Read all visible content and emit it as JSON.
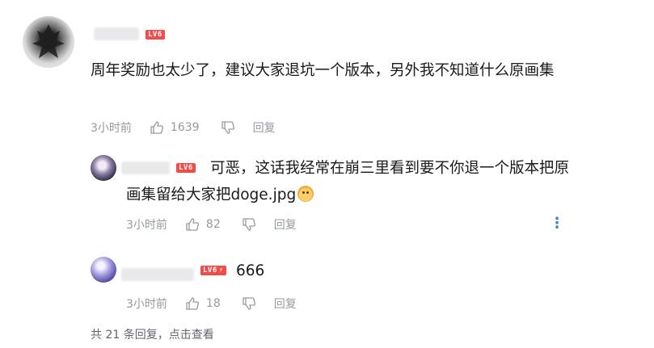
{
  "comments": [
    {
      "level": "LV6",
      "text": "周年奖励也太少了，建议大家退坑一个版本，另外我不知道什么原画集",
      "time": "3小时前",
      "likes": "1639",
      "reply_label": "回复"
    }
  ],
  "replies": [
    {
      "level": "LV6",
      "text_line1": "可恶，这话我经常在崩三里看到要不你退一个版本把原",
      "text_line2": "画集留给大家把doge.jpg",
      "time": "3小时前",
      "likes": "82",
      "reply_label": "回复",
      "has_more_menu": true,
      "emoji": "doge-emoji"
    },
    {
      "level": "LV6",
      "text": "666",
      "time": "3小时前",
      "likes": "18",
      "reply_label": "回复"
    }
  ],
  "footer": {
    "text": "共 21 条回复，点击查看"
  },
  "colors": {
    "level_badge": "#f04c49",
    "meta_text": "#9499a0",
    "body_text": "#18191c",
    "more_icon": "#3b82c4"
  }
}
